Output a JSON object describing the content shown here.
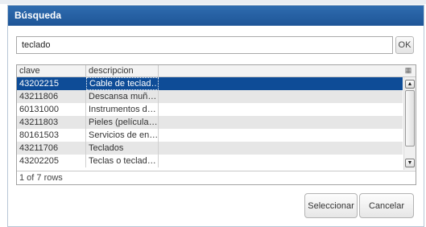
{
  "dialog": {
    "title": "Búsqueda"
  },
  "search": {
    "value": "teclado",
    "ok_label": "OK"
  },
  "grid": {
    "columns": [
      "clave",
      "descripcion"
    ],
    "rows": [
      {
        "clave": "43202215",
        "descripcion": "Cable de teclad…",
        "selected": true
      },
      {
        "clave": "43211806",
        "descripcion": "Descansa muñ…"
      },
      {
        "clave": "60131000",
        "descripcion": "Instrumentos d…"
      },
      {
        "clave": "43211803",
        "descripcion": "Pieles (película…"
      },
      {
        "clave": "80161503",
        "descripcion": "Servicios de en…"
      },
      {
        "clave": "43211706",
        "descripcion": "Teclados"
      },
      {
        "clave": "43202205",
        "descripcion": "Teclas o teclad…"
      }
    ],
    "status": "1 of 7 rows"
  },
  "buttons": {
    "select_label": "Seleccionar",
    "cancel_label": "Cancelar"
  },
  "colors": {
    "titlebar": "#1e5597",
    "selection": "#0e4c97",
    "alt_row": "#e6e6e6"
  },
  "icons": {
    "grid_menu": "grid-menu-icon",
    "scroll_up": "scroll-up-icon",
    "scroll_down": "scroll-down-icon"
  }
}
